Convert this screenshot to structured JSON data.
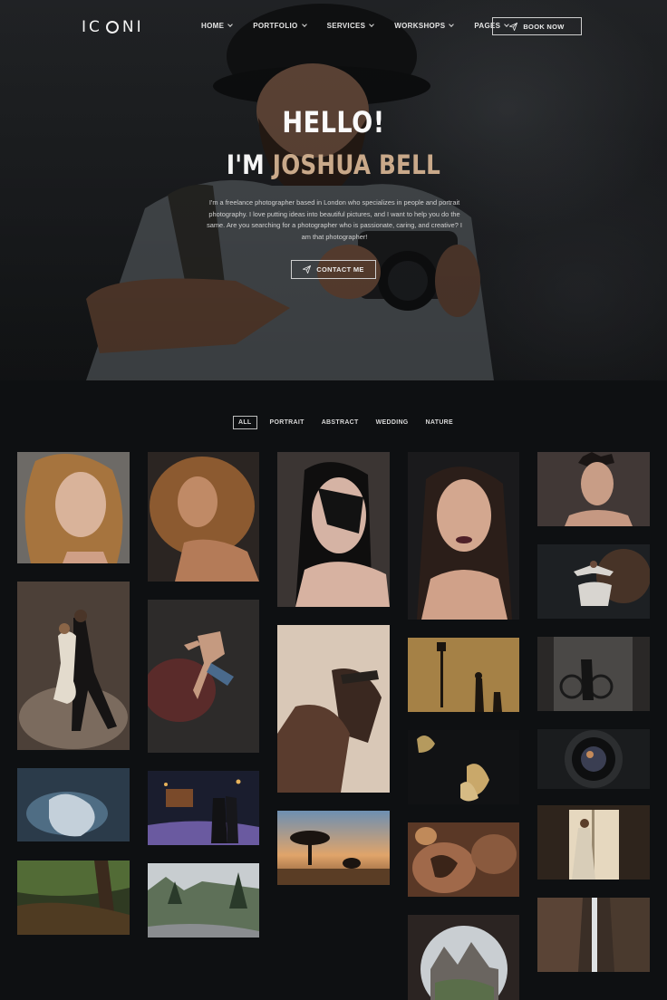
{
  "nav": {
    "logo": {
      "left": "IC",
      "right": "NI"
    },
    "menu": [
      {
        "label": "HOME"
      },
      {
        "label": "PORTFOLIO"
      },
      {
        "label": "SERVICES"
      },
      {
        "label": "WORKSHOPS"
      },
      {
        "label": "PAGES"
      }
    ],
    "book_label": "BOOK NOW"
  },
  "hero": {
    "hello": "HELLO!",
    "im": "I'M ",
    "name": "JOSHUA BELL",
    "intro": "I'm a freelance photographer based in London who specializes in people and portrait photography. I love putting ideas into beautiful pictures, and I want to help you do the same. Are you searching for a photographer who is passionate, caring, and creative? I am that photographer!",
    "contact_label": "CONTACT ME"
  },
  "filters": [
    {
      "label": "ALL",
      "active": true
    },
    {
      "label": "PORTRAIT",
      "active": false
    },
    {
      "label": "ABSTRACT",
      "active": false
    },
    {
      "label": "WEDDING",
      "active": false
    },
    {
      "label": "NATURE",
      "active": false
    }
  ],
  "gallery": [
    {
      "name": "photo-woman-wavy-hair"
    },
    {
      "name": "photo-woman-curly-hair"
    },
    {
      "name": "photo-painted-face"
    },
    {
      "name": "photo-wet-hair-portrait"
    },
    {
      "name": "photo-woman-braids"
    },
    {
      "name": "photo-tango-dancers"
    },
    {
      "name": "photo-jumping-dancer"
    },
    {
      "name": "photo-man-hands-face"
    },
    {
      "name": "photo-underwater-dress"
    },
    {
      "name": "photo-ballerina"
    },
    {
      "name": "photo-street-lamp-shadows"
    },
    {
      "name": "photo-studio-bikes"
    },
    {
      "name": "photo-couple-lights"
    },
    {
      "name": "photo-gold-leaves"
    },
    {
      "name": "photo-camera-lens"
    },
    {
      "name": "photo-acacia-elephant"
    },
    {
      "name": "photo-bride-window"
    },
    {
      "name": "photo-forest-stream"
    },
    {
      "name": "photo-mountain-road"
    },
    {
      "name": "photo-tattooed-back"
    },
    {
      "name": "photo-waterfall-canyon"
    },
    {
      "name": "photo-cave-dolomites"
    }
  ],
  "colors": {
    "accent": "#c9a98a",
    "background": "#0e1012"
  }
}
